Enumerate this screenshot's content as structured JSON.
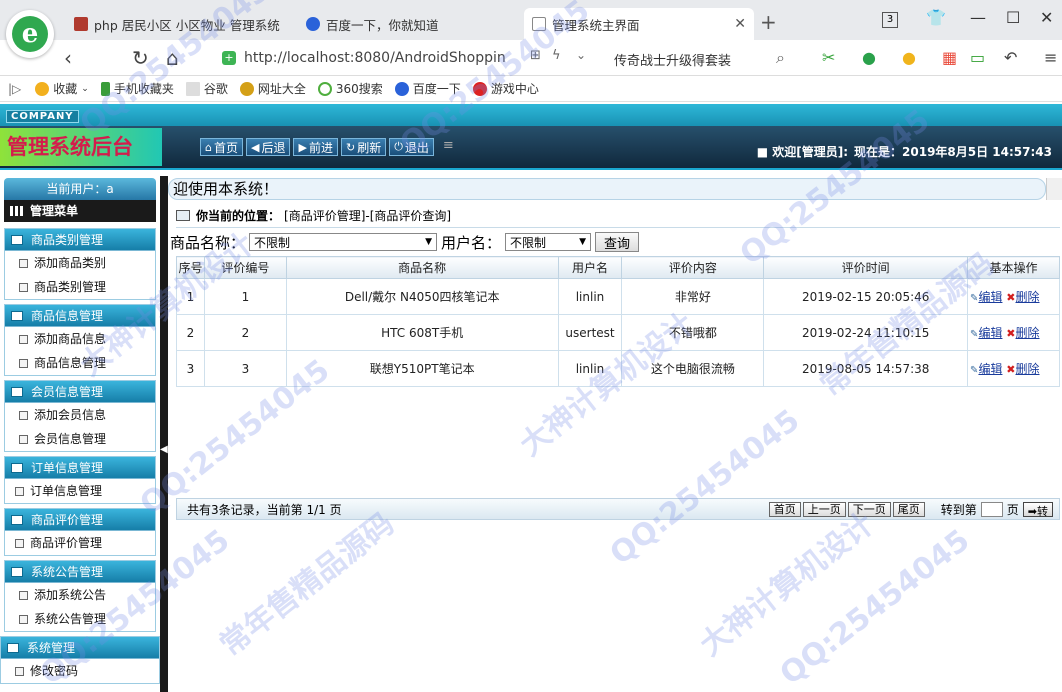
{
  "browser": {
    "tabs": [
      {
        "title": "php 居民小区 小区物业 管理系统",
        "fav_color": "#b03a2e"
      },
      {
        "title": "百度一下，你就知道",
        "fav_color": "#2a62d9"
      },
      {
        "title": "管理系统主界面",
        "fav_color": "#888888"
      }
    ],
    "tab_count": "3",
    "url": "http://localhost:8080/AndroidShoppin",
    "promo": "传奇战士升级得套装",
    "bookmarks": [
      "收藏",
      "手机收藏夹",
      "谷歌",
      "网址大全",
      "360搜索",
      "百度一下",
      "游戏中心"
    ]
  },
  "app": {
    "company": "COMPANY",
    "title": "管理系统后台",
    "nav": [
      {
        "label": "首页",
        "icon": "home-icon",
        "glyph": "⌂"
      },
      {
        "label": "后退",
        "icon": "back-icon",
        "glyph": "◀"
      },
      {
        "label": "前进",
        "icon": "forward-icon",
        "glyph": "▶"
      },
      {
        "label": "刷新",
        "icon": "refresh-icon",
        "glyph": "↻"
      },
      {
        "label": "退出",
        "icon": "power-icon",
        "glyph": "⏻"
      }
    ],
    "welcome_user": "■ 欢迎[管理员]:",
    "now_label": "现在是：2019年8月5日 14:57:43",
    "marquee": "迎使用本系统！"
  },
  "sidebar": {
    "current_user": "当前用户：a",
    "menu_title": "管理菜单",
    "groups": [
      {
        "title": "商品类别管理",
        "items": [
          "添加商品类别",
          "商品类别管理"
        ]
      },
      {
        "title": "商品信息管理",
        "items": [
          "添加商品信息",
          "商品信息管理"
        ]
      },
      {
        "title": "会员信息管理",
        "items": [
          "添加会员信息",
          "会员信息管理"
        ]
      },
      {
        "title": "订单信息管理",
        "items": [
          "订单信息管理"
        ]
      },
      {
        "title": "商品评价管理",
        "items": [
          "商品评价管理"
        ]
      },
      {
        "title": "系统公告管理",
        "items": [
          "添加系统公告",
          "系统公告管理"
        ]
      },
      {
        "title": "系统管理",
        "items": [
          "修改密码"
        ]
      }
    ]
  },
  "main": {
    "crumb_label": "你当前的位置：",
    "crumb_path": "[商品评价管理]-[商品评价查询]",
    "filter_product_label": "商品名称：",
    "filter_product_value": "不限制",
    "filter_user_label": "用户名：",
    "filter_user_value": "不限制",
    "query_button": "查询",
    "columns": [
      "序号",
      "评价编号",
      "商品名称",
      "用户名",
      "评价内容",
      "评价时间",
      "基本操作"
    ],
    "rows": [
      [
        "1",
        "1",
        "Dell/戴尔 N4050四核笔记本",
        "linlin",
        "非常好",
        "2019-02-15 20:05:46"
      ],
      [
        "2",
        "2",
        "HTC 608T手机",
        "usertest",
        "不错哦都",
        "2019-02-24 11:10:15"
      ],
      [
        "3",
        "3",
        "联想Y510PT笔记本",
        "linlin",
        "这个电脑很流畅",
        "2019-08-05 14:57:38"
      ]
    ],
    "edit_label": "编辑",
    "delete_label": "删除",
    "pager_info": "共有3条记录，当前第 1/1 页",
    "first_page": "首页",
    "prev_page": "上一页",
    "next_page": "下一页",
    "last_page": "尾页",
    "goto_label": "转到第",
    "page_unit": "页",
    "go_button": "➡转"
  },
  "watermarks": [
    "QQ:25454045",
    "大神计算机设计",
    "常年售精品源码"
  ]
}
